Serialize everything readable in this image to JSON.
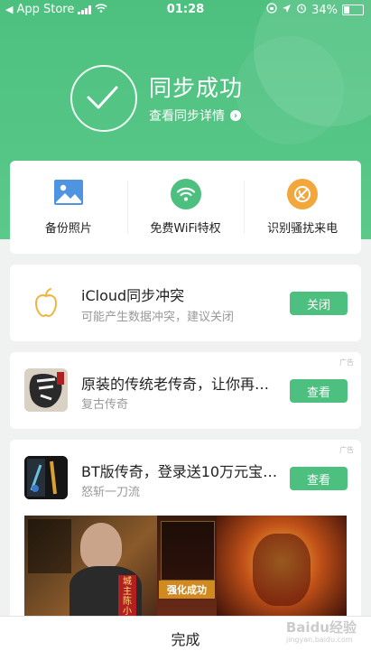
{
  "status_bar": {
    "carrier": "App Store",
    "time": "01:28",
    "battery": "34%"
  },
  "header": {
    "title": "同步成功",
    "details_link": "查看同步详情"
  },
  "features": [
    {
      "label": "备份照片",
      "icon": "photo-icon",
      "color": "#4f94e0"
    },
    {
      "label": "免费WiFi特权",
      "icon": "wifi-icon",
      "color": "#4dc07f"
    },
    {
      "label": "识别骚扰来电",
      "icon": "block-call-icon",
      "color": "#f2a73c"
    }
  ],
  "icloud": {
    "title": "iCloud同步冲突",
    "subtitle": "可能产生数据冲突，建议关闭",
    "button": "关闭"
  },
  "ads": [
    {
      "tag": "广告",
      "title": "原装的传统老传奇，让你再…",
      "subtitle": "复古传奇",
      "button": "查看"
    },
    {
      "tag": "广告",
      "title": "BT版传奇，登录送10万元宝…",
      "subtitle": "怒斩一刀流",
      "button": "查看",
      "banner_texts": [
        "强化成功",
        "城主 陈小"
      ]
    }
  ],
  "footer": {
    "done_label": "完成"
  },
  "watermark": {
    "brand": "Baidu经验",
    "url": "jingyan.baidu.com"
  },
  "colors": {
    "accent": "#4dc07f",
    "background": "#f0f2f2"
  }
}
